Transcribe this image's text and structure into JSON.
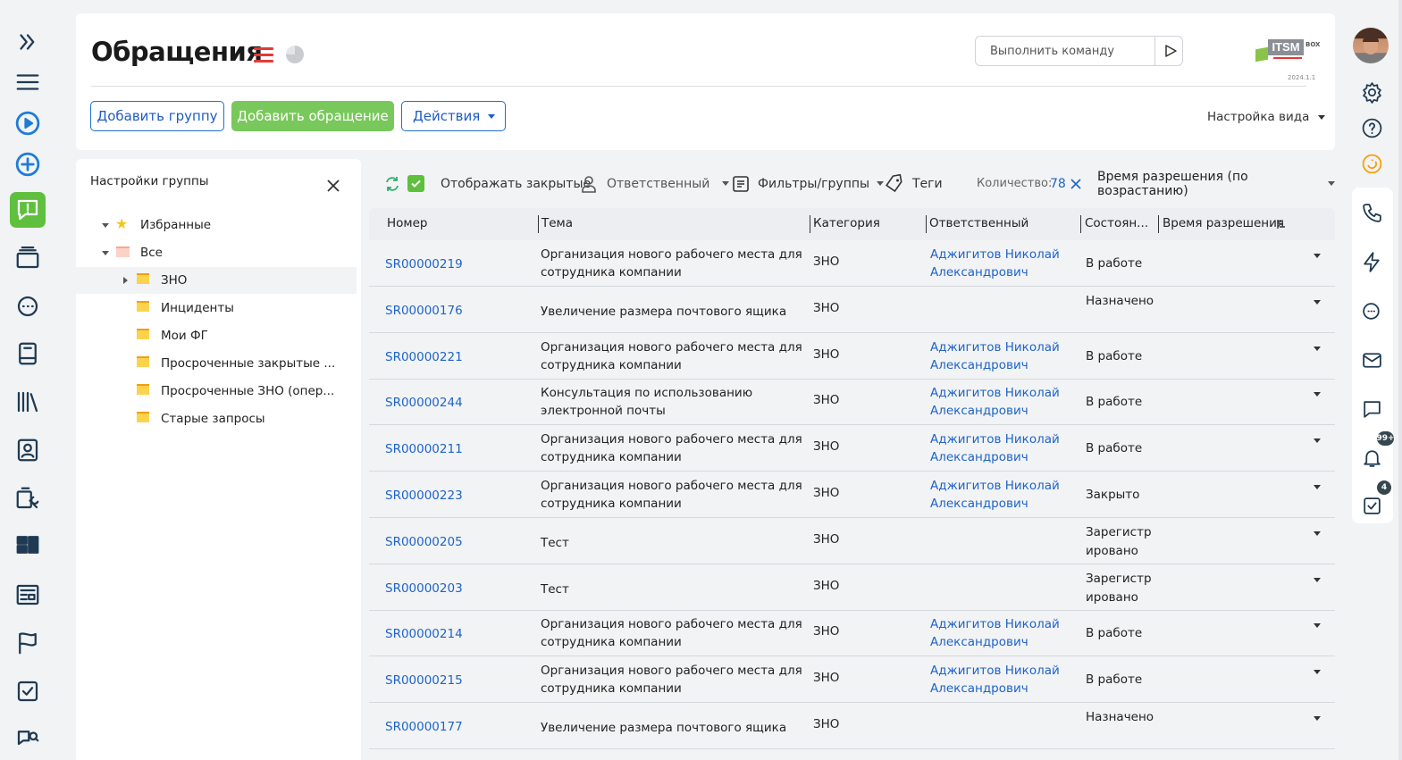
{
  "page": {
    "title": "Обращения"
  },
  "left_sidebar": {
    "icons": [
      "expand-icon",
      "menu-icon",
      "play-icon",
      "plus-icon",
      "requests-icon",
      "layers-icon",
      "chat-icon",
      "book-icon",
      "library-icon",
      "contacts-icon",
      "tools-icon",
      "dashboard-icon",
      "news-icon",
      "flag-icon",
      "checklist-icon",
      "search-chat-icon"
    ]
  },
  "header": {
    "command_placeholder": "Выполнить команду",
    "logo_text": "ITSM",
    "logo_sub": "BOX",
    "version": "2024.1.1",
    "buttons": {
      "add_group": "Добавить группу",
      "add_request": "Добавить обращение",
      "actions": "Действия"
    },
    "view_settings": "Настройка вида"
  },
  "group_panel": {
    "title": "Настройки группы",
    "items": [
      {
        "label": "Избранные",
        "icon": "star-icon"
      },
      {
        "label": "Все",
        "icon": "folder-icon"
      },
      {
        "label": "ЗНО",
        "icon": "folder-icon"
      },
      {
        "label": "Инциденты",
        "icon": "folder-icon"
      },
      {
        "label": "Мои ФГ",
        "icon": "folder-icon"
      },
      {
        "label": "Просроченные закрытые ...",
        "icon": "folder-icon"
      },
      {
        "label": "Просроченные ЗНО (опер...",
        "icon": "folder-icon"
      },
      {
        "label": "Старые запросы",
        "icon": "folder-icon"
      }
    ]
  },
  "toolbar": {
    "show_closed": "Отображать закрытые",
    "responsible": "Ответственный",
    "filters": "Фильтры/группы",
    "tags": "Теги",
    "count_label": "Количество:",
    "count_value": "78",
    "sort": "Время разрешения (по возрастанию)"
  },
  "table": {
    "columns": [
      "Номер",
      "Тема",
      "Категория",
      "Ответственный",
      "Состоян...",
      "Время разрешения"
    ],
    "rows": [
      {
        "num": "SR00000219",
        "topic": "Организация нового рабочего места для сотрудника компании",
        "cat": "ЗНО",
        "resp": "Аджигитов Николай Александрович",
        "status": "В работе"
      },
      {
        "num": "SR00000176",
        "topic": "Увеличение размера почтового ящика",
        "cat": "ЗНО",
        "resp": "",
        "status": "Назначено"
      },
      {
        "num": "SR00000221",
        "topic": "Организация нового рабочего места для сотрудника компании",
        "cat": "ЗНО",
        "resp": "Аджигитов Николай Александрович",
        "status": "В работе"
      },
      {
        "num": "SR00000244",
        "topic": "Консультация по использованию электронной почты",
        "cat": "ЗНО",
        "resp": "Аджигитов Николай Александрович",
        "status": "В работе"
      },
      {
        "num": "SR00000211",
        "topic": "Организация нового рабочего места для сотрудника компании",
        "cat": "ЗНО",
        "resp": "Аджигитов Николай Александрович",
        "status": "В работе"
      },
      {
        "num": "SR00000223",
        "topic": "Организация нового рабочего места для сотрудника компании",
        "cat": "ЗНО",
        "resp": "Аджигитов Николай Александрович",
        "status": "Закрыто"
      },
      {
        "num": "SR00000205",
        "topic": "Тест",
        "cat": "ЗНО",
        "resp": "",
        "status": "Зарегистрировано"
      },
      {
        "num": "SR00000203",
        "topic": "Тест",
        "cat": "ЗНО",
        "resp": "",
        "status": "Зарегистрировано"
      },
      {
        "num": "SR00000214",
        "topic": "Организация нового рабочего места для сотрудника компании",
        "cat": "ЗНО",
        "resp": "Аджигитов Николай Александрович",
        "status": "В работе"
      },
      {
        "num": "SR00000215",
        "topic": "Организация нового рабочего места для сотрудника компании",
        "cat": "ЗНО",
        "resp": "Аджигитов Николай Александрович",
        "status": "В работе"
      },
      {
        "num": "SR00000177",
        "topic": "Увеличение размера почтового ящика",
        "cat": "ЗНО",
        "resp": "",
        "status": "Назначено"
      }
    ]
  },
  "right_sidebar": {
    "icons": [
      "avatar",
      "settings-icon",
      "help-icon",
      "support-icon",
      "phone-icon",
      "lightning-icon",
      "chat-icon",
      "mail-icon",
      "message-icon",
      "bell-icon",
      "tasks-icon"
    ],
    "bell_badge": "99+",
    "tasks_badge": "4"
  },
  "colors": {
    "accent": "#79c85b",
    "link": "#1e64c8",
    "danger": "#e53935"
  }
}
